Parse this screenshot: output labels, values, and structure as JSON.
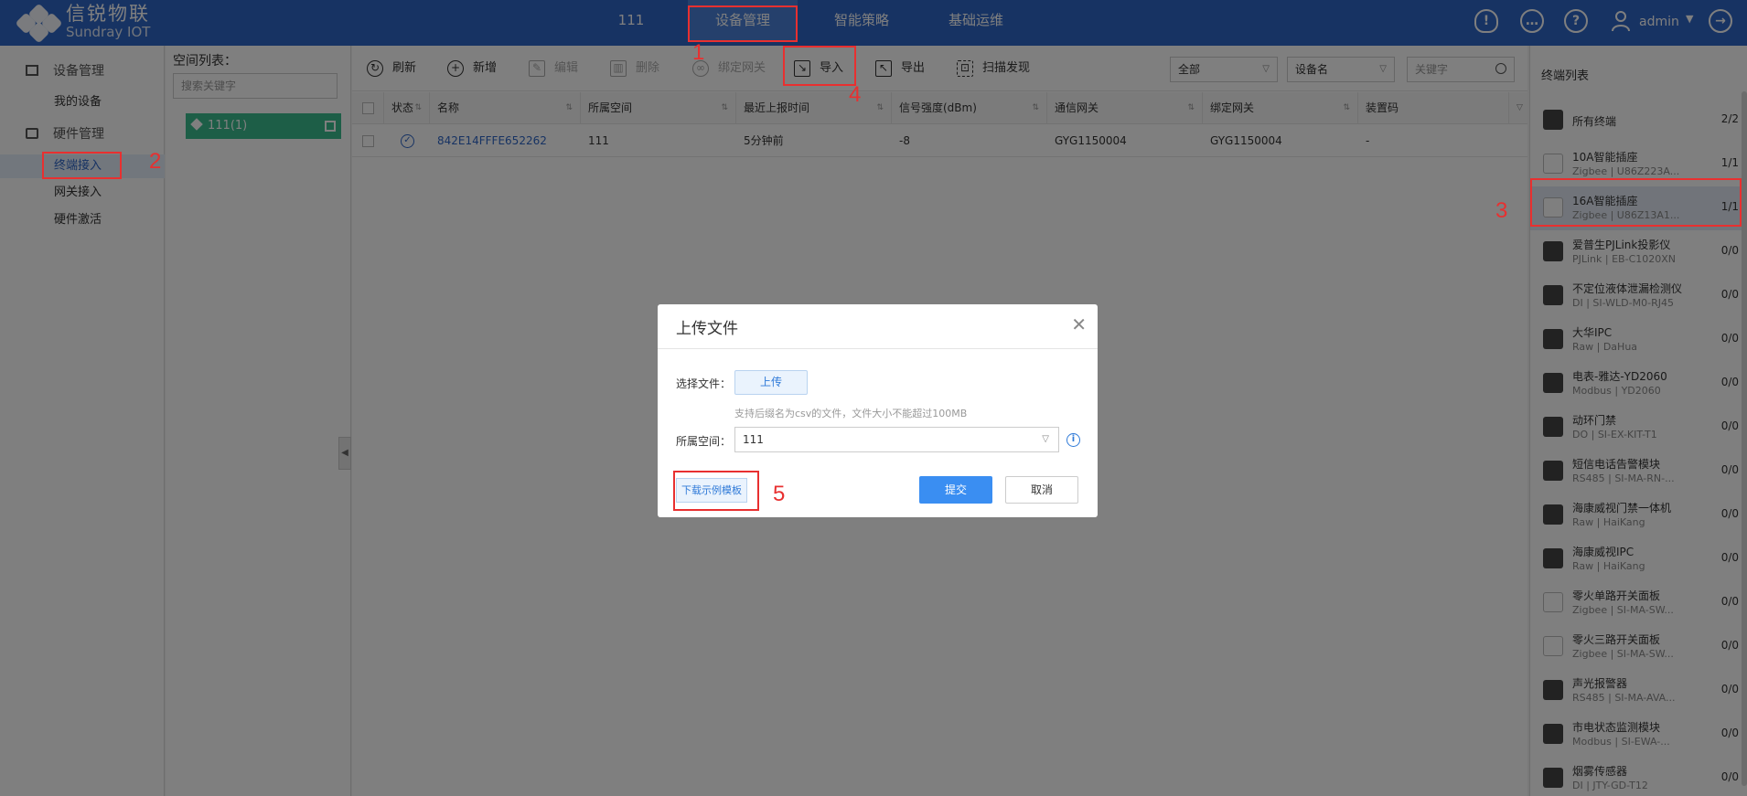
{
  "app": {
    "logo_cn": "信锐物联",
    "logo_en": "Sundray IOT"
  },
  "topnav": {
    "items": [
      {
        "label": "111"
      },
      {
        "label": "设备管理"
      },
      {
        "label": "智能策略"
      },
      {
        "label": "基础运维"
      }
    ],
    "user": "admin"
  },
  "sidebar": {
    "groups": [
      {
        "label": "设备管理",
        "items": [
          "我的设备"
        ]
      },
      {
        "label": "硬件管理",
        "items": [
          "终端接入",
          "网关接入",
          "硬件激活"
        ]
      }
    ]
  },
  "space": {
    "title": "空间列表：",
    "search_placeholder": "搜索关键字",
    "node": "111(1)"
  },
  "toolbar": {
    "refresh": "刷新",
    "add": "新增",
    "edit": "编辑",
    "delete": "删除",
    "bind": "绑定网关",
    "import": "导入",
    "export": "导出",
    "scan": "扫描发现",
    "filter_all": "全部",
    "filter_field": "设备名",
    "keyword_placeholder": "关键字"
  },
  "table": {
    "headers": [
      "状态",
      "名称",
      "所属空间",
      "最近上报时间",
      "信号强度(dBm)",
      "通信网关",
      "绑定网关",
      "装置码"
    ],
    "rows": [
      {
        "name": "842E14FFFE652262",
        "space": "111",
        "last_report": "5分钟前",
        "signal": "-8",
        "comm_gateway": "GYG1150004",
        "bind_gateway": "GYG1150004",
        "code": "-"
      }
    ]
  },
  "terminals": {
    "title": "终端列表",
    "items": [
      {
        "name": "所有终端",
        "sub": "",
        "count": "2/2"
      },
      {
        "name": "10A智能插座",
        "sub": "Zigbee | U86Z223A...",
        "count": "1/1"
      },
      {
        "name": "16A智能插座",
        "sub": "Zigbee | U86Z13A1...",
        "count": "1/1"
      },
      {
        "name": "爱普生PJLink投影仪",
        "sub": "PJLink | EB-C1020XN",
        "count": "0/0"
      },
      {
        "name": "不定位液体泄漏检测仪",
        "sub": "DI | SI-WLD-M0-RJ45",
        "count": "0/0"
      },
      {
        "name": "大华IPC",
        "sub": "Raw | DaHua",
        "count": "0/0"
      },
      {
        "name": "电表-雅达-YD2060",
        "sub": "Modbus | YD2060",
        "count": "0/0"
      },
      {
        "name": "动环门禁",
        "sub": "DO | SI-EX-KIT-T1",
        "count": "0/0"
      },
      {
        "name": "短信电话告警模块",
        "sub": "RS485 | SI-MA-RN-...",
        "count": "0/0"
      },
      {
        "name": "海康威视门禁一体机",
        "sub": "Raw | HaiKang",
        "count": "0/0"
      },
      {
        "name": "海康威视IPC",
        "sub": "Raw | HaiKang",
        "count": "0/0"
      },
      {
        "name": "零火单路开关面板",
        "sub": "Zigbee | SI-MA-SW...",
        "count": "0/0"
      },
      {
        "name": "零火三路开关面板",
        "sub": "Zigbee | SI-MA-SW...",
        "count": "0/0"
      },
      {
        "name": "声光报警器",
        "sub": "RS485 | SI-MA-AVA...",
        "count": "0/0"
      },
      {
        "name": "市电状态监测模块",
        "sub": "Modbus | SI-EWA-...",
        "count": "0/0"
      },
      {
        "name": "烟雾传感器",
        "sub": "DI | JTY-GD-T12",
        "count": "0/0"
      }
    ]
  },
  "dialog": {
    "title": "上传文件",
    "file_label": "选择文件：",
    "upload": "上传",
    "hint": "支持后缀名为csv的文件，文件大小不能超过100MB",
    "space_label": "所属空间：",
    "space_value": "111",
    "template": "下载示例模板",
    "submit": "提交",
    "cancel": "取消"
  },
  "annotations": [
    "1",
    "2",
    "3",
    "4",
    "5"
  ],
  "colors": {
    "brand": "#2f66c7",
    "accent": "#3a8ef2",
    "annotation": "#e83030",
    "space_node": "#3bbc8f"
  }
}
